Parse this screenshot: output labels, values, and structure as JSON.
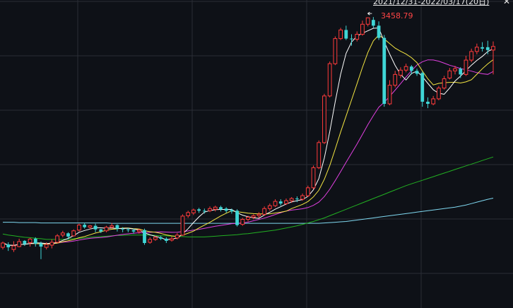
{
  "header": {
    "range_readout": "2021/12/31-2022/03/17(20日)",
    "close_icon": "close-icon"
  },
  "annotation": {
    "peak_label": "3458.79",
    "peak_marker_icon": "arrow-left-icon"
  },
  "colors": {
    "background": "#0e1117",
    "grid": "#2a2d35",
    "up": "#ff3b3b",
    "down": "#3fd6d6",
    "ma5": "#ffffff",
    "ma10": "#f5e642",
    "ma20": "#e040e0",
    "ma60": "#22b022",
    "ma120": "#7fd8f0"
  },
  "chart_data": {
    "type": "candlestick",
    "price_range": [
      2700,
      3480
    ],
    "grid": true,
    "peak": 3458.79,
    "candles": [
      [
        2818,
        2830,
        2812,
        2834
      ],
      [
        2826,
        2818,
        2808,
        2832
      ],
      [
        2812,
        2822,
        2805,
        2835
      ],
      [
        2820,
        2834,
        2818,
        2842
      ],
      [
        2836,
        2827,
        2822,
        2838
      ],
      [
        2831,
        2841,
        2820,
        2844
      ],
      [
        2842,
        2828,
        2820,
        2846
      ],
      [
        2829,
        2820,
        2785,
        2834
      ],
      [
        2818,
        2826,
        2812,
        2832
      ],
      [
        2824,
        2832,
        2815,
        2840
      ],
      [
        2832,
        2850,
        2830,
        2855
      ],
      [
        2852,
        2858,
        2846,
        2864
      ],
      [
        2857,
        2848,
        2840,
        2860
      ],
      [
        2850,
        2864,
        2848,
        2868
      ],
      [
        2866,
        2880,
        2862,
        2884
      ],
      [
        2881,
        2874,
        2870,
        2886
      ],
      [
        2874,
        2878,
        2868,
        2880
      ],
      [
        2878,
        2868,
        2860,
        2884
      ],
      [
        2868,
        2862,
        2858,
        2870
      ],
      [
        2864,
        2874,
        2860,
        2878
      ],
      [
        2874,
        2878,
        2870,
        2886
      ],
      [
        2880,
        2870,
        2862,
        2882
      ],
      [
        2870,
        2868,
        2860,
        2874
      ],
      [
        2868,
        2866,
        2860,
        2872
      ],
      [
        2866,
        2862,
        2856,
        2870
      ],
      [
        2862,
        2866,
        2856,
        2870
      ],
      [
        2866,
        2830,
        2825,
        2870
      ],
      [
        2832,
        2840,
        2828,
        2846
      ],
      [
        2840,
        2846,
        2836,
        2850
      ],
      [
        2846,
        2842,
        2838,
        2850
      ],
      [
        2842,
        2836,
        2830,
        2846
      ],
      [
        2838,
        2842,
        2834,
        2848
      ],
      [
        2844,
        2852,
        2840,
        2858
      ],
      [
        2852,
        2905,
        2850,
        2910
      ],
      [
        2906,
        2915,
        2900,
        2920
      ],
      [
        2914,
        2922,
        2908,
        2926
      ],
      [
        2924,
        2920,
        2914,
        2928
      ],
      [
        2920,
        2918,
        2912,
        2926
      ],
      [
        2920,
        2926,
        2916,
        2932
      ],
      [
        2924,
        2930,
        2918,
        2934
      ],
      [
        2930,
        2924,
        2918,
        2934
      ],
      [
        2926,
        2920,
        2914,
        2930
      ],
      [
        2922,
        2918,
        2912,
        2926
      ],
      [
        2920,
        2880,
        2876,
        2924
      ],
      [
        2882,
        2896,
        2878,
        2900
      ],
      [
        2896,
        2902,
        2890,
        2906
      ],
      [
        2902,
        2906,
        2896,
        2910
      ],
      [
        2906,
        2910,
        2900,
        2916
      ],
      [
        2910,
        2926,
        2906,
        2932
      ],
      [
        2926,
        2934,
        2920,
        2940
      ],
      [
        2934,
        2946,
        2930,
        2952
      ],
      [
        2946,
        2940,
        2934,
        2952
      ],
      [
        2940,
        2948,
        2936,
        2954
      ],
      [
        2948,
        2954,
        2942,
        2958
      ],
      [
        2954,
        2952,
        2944,
        2960
      ],
      [
        2952,
        2962,
        2948,
        2968
      ],
      [
        2962,
        2984,
        2958,
        2990
      ],
      [
        2984,
        3040,
        2980,
        3046
      ],
      [
        3040,
        3110,
        3036,
        3116
      ],
      [
        3110,
        3240,
        3106,
        3246
      ],
      [
        3240,
        3330,
        3236,
        3336
      ],
      [
        3330,
        3400,
        3326,
        3406
      ],
      [
        3400,
        3424,
        3396,
        3430
      ],
      [
        3424,
        3400,
        3396,
        3436
      ],
      [
        3400,
        3398,
        3380,
        3412
      ],
      [
        3398,
        3412,
        3392,
        3420
      ],
      [
        3412,
        3440,
        3408,
        3450
      ],
      [
        3440,
        3458,
        3434,
        3459
      ],
      [
        3452,
        3436,
        3430,
        3460
      ],
      [
        3436,
        3402,
        3396,
        3448
      ],
      [
        3402,
        3218,
        3210,
        3410
      ],
      [
        3218,
        3270,
        3214,
        3284
      ],
      [
        3270,
        3300,
        3264,
        3310
      ],
      [
        3298,
        3312,
        3290,
        3320
      ],
      [
        3312,
        3322,
        3306,
        3330
      ],
      [
        3322,
        3310,
        3300,
        3326
      ],
      [
        3310,
        3302,
        3296,
        3316
      ],
      [
        3304,
        3224,
        3210,
        3308
      ],
      [
        3224,
        3218,
        3206,
        3236
      ],
      [
        3218,
        3232,
        3214,
        3240
      ],
      [
        3232,
        3262,
        3228,
        3268
      ],
      [
        3262,
        3288,
        3258,
        3296
      ],
      [
        3290,
        3310,
        3286,
        3318
      ],
      [
        3310,
        3316,
        3300,
        3324
      ],
      [
        3316,
        3300,
        3290,
        3320
      ],
      [
        3300,
        3340,
        3296,
        3352
      ],
      [
        3340,
        3364,
        3334,
        3372
      ],
      [
        3364,
        3376,
        3356,
        3386
      ],
      [
        3376,
        3372,
        3364,
        3390
      ],
      [
        3376,
        3368,
        3356,
        3394
      ],
      [
        3368,
        3378,
        3300,
        3392
      ]
    ],
    "ma60": [
      2855,
      2852,
      2850,
      2848,
      2846,
      2845,
      2843,
      2842,
      2840,
      2840,
      2840,
      2840,
      2841,
      2842,
      2843,
      2844,
      2846,
      2847,
      2848,
      2849,
      2850,
      2851,
      2851,
      2852,
      2852,
      2852,
      2852,
      2852,
      2851,
      2850,
      2850,
      2849,
      2848,
      2848,
      2847,
      2847,
      2847,
      2847,
      2848,
      2849,
      2850,
      2851,
      2852,
      2853,
      2855,
      2856,
      2858,
      2860,
      2862,
      2864,
      2866,
      2869,
      2872,
      2875,
      2878,
      2882,
      2886,
      2890,
      2895,
      2900,
      2906,
      2912,
      2918,
      2924,
      2930,
      2936,
      2942,
      2948,
      2954,
      2960,
      2966,
      2972,
      2978,
      2984,
      2990,
      2995,
      3000,
      3005,
      3010,
      3015,
      3020,
      3025,
      3030,
      3035,
      3040,
      3045,
      3050,
      3055,
      3060,
      3065,
      3070
    ],
    "ma120": [
      2888,
      2888,
      2888,
      2887,
      2887,
      2887,
      2887,
      2886,
      2886,
      2886,
      2886,
      2886,
      2886,
      2886,
      2886,
      2886,
      2886,
      2886,
      2886,
      2886,
      2885,
      2885,
      2885,
      2885,
      2885,
      2885,
      2885,
      2885,
      2885,
      2885,
      2885,
      2885,
      2885,
      2885,
      2885,
      2885,
      2885,
      2885,
      2885,
      2885,
      2885,
      2885,
      2885,
      2885,
      2885,
      2885,
      2885,
      2885,
      2885,
      2885,
      2885,
      2885,
      2885,
      2885,
      2885,
      2885,
      2885,
      2885,
      2885,
      2886,
      2887,
      2888,
      2889,
      2890,
      2892,
      2894,
      2896,
      2898,
      2900,
      2902,
      2904,
      2906,
      2908,
      2910,
      2912,
      2914,
      2916,
      2918,
      2920,
      2922,
      2924,
      2926,
      2928,
      2930,
      2933,
      2936,
      2940,
      2944,
      2948,
      2952,
      2955
    ]
  }
}
